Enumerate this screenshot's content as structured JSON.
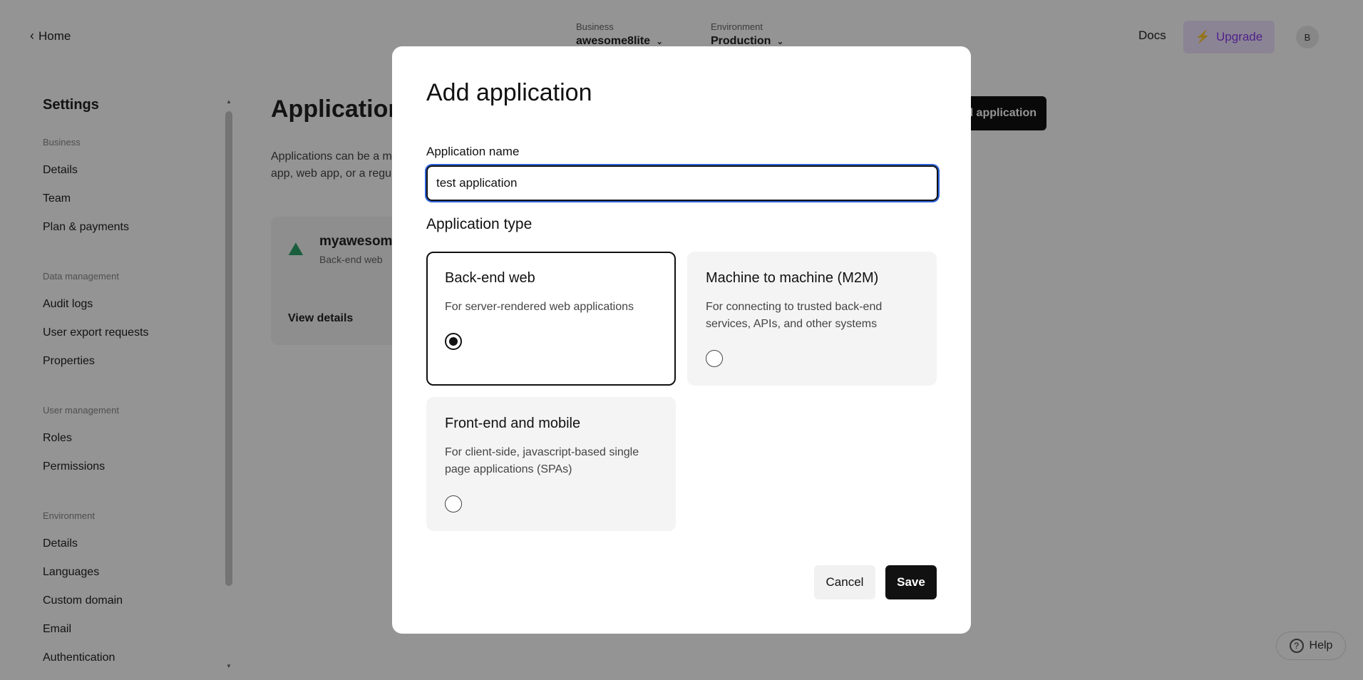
{
  "topbar": {
    "home_label": "Home",
    "business_label": "Business",
    "business_value": "awesome8lite",
    "environment_label": "Environment",
    "environment_value": "Production",
    "docs_label": "Docs",
    "upgrade_label": "Upgrade",
    "avatar_initial": "B"
  },
  "sidebar": {
    "title": "Settings",
    "groups": [
      {
        "label": "Business",
        "items": [
          "Details",
          "Team",
          "Plan & payments"
        ]
      },
      {
        "label": "Data management",
        "items": [
          "Audit logs",
          "User export requests",
          "Properties"
        ]
      },
      {
        "label": "User management",
        "items": [
          "Roles",
          "Permissions"
        ]
      },
      {
        "label": "Environment",
        "items": [
          "Details",
          "Languages",
          "Custom domain",
          "Email",
          "Authentication"
        ]
      }
    ]
  },
  "main": {
    "title": "Applications",
    "description": "Applications can be a mobile app, web app, or a regular",
    "add_button_label": "Add application",
    "app_card": {
      "name": "myawesom",
      "type": "Back-end web",
      "link": "View details"
    },
    "help_label": "Help"
  },
  "modal": {
    "title": "Add application",
    "name_label": "Application name",
    "name_value": "test application",
    "type_label": "Application type",
    "types": [
      {
        "title": "Back-end web",
        "description": "For server-rendered web applications",
        "selected": true
      },
      {
        "title": "Machine to machine (M2M)",
        "description": "For connecting to trusted back-end services, APIs, and other systems",
        "selected": false
      },
      {
        "title": "Front-end and mobile",
        "description": "For client-side, javascript-based single page applications (SPAs)",
        "selected": false
      }
    ],
    "cancel_label": "Cancel",
    "save_label": "Save"
  },
  "colors": {
    "focus_ring": "#2d63d8",
    "primary": "#111111",
    "upgrade_bg": "#efe3ff",
    "upgrade_fg": "#8b3cf0",
    "app_icon": "#2ea26b"
  }
}
